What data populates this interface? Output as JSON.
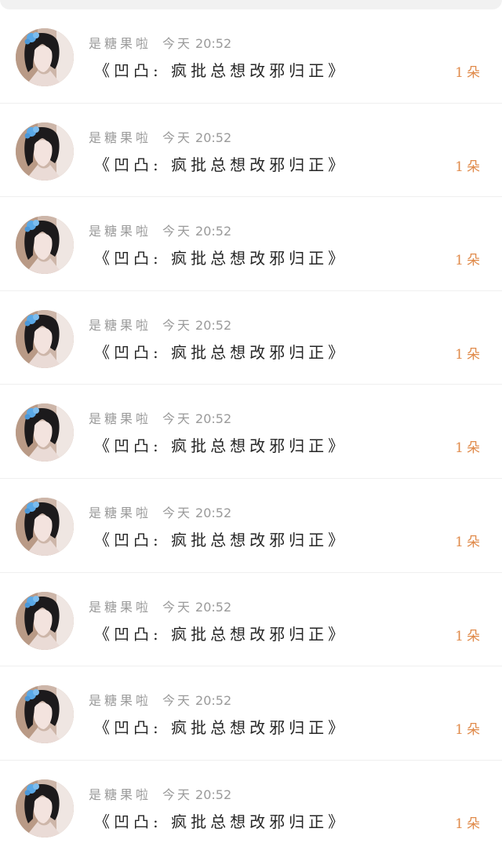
{
  "messages": [
    {
      "sender": "是糖果啦",
      "day": "今天",
      "time": "20:52",
      "text": "《凹凸: 疯批总想改邪归正》",
      "count": "1朵",
      "avatar": "avatar-girl-with-blue-flower"
    },
    {
      "sender": "是糖果啦",
      "day": "今天",
      "time": "20:52",
      "text": "《凹凸: 疯批总想改邪归正》",
      "count": "1朵",
      "avatar": "avatar-girl-with-blue-flower"
    },
    {
      "sender": "是糖果啦",
      "day": "今天",
      "time": "20:52",
      "text": "《凹凸: 疯批总想改邪归正》",
      "count": "1朵",
      "avatar": "avatar-girl-with-blue-flower"
    },
    {
      "sender": "是糖果啦",
      "day": "今天",
      "time": "20:52",
      "text": "《凹凸: 疯批总想改邪归正》",
      "count": "1朵",
      "avatar": "avatar-girl-with-blue-flower"
    },
    {
      "sender": "是糖果啦",
      "day": "今天",
      "time": "20:52",
      "text": "《凹凸: 疯批总想改邪归正》",
      "count": "1朵",
      "avatar": "avatar-girl-with-blue-flower"
    },
    {
      "sender": "是糖果啦",
      "day": "今天",
      "time": "20:52",
      "text": "《凹凸: 疯批总想改邪归正》",
      "count": "1朵",
      "avatar": "avatar-girl-with-blue-flower"
    },
    {
      "sender": "是糖果啦",
      "day": "今天",
      "time": "20:52",
      "text": "《凹凸: 疯批总想改邪归正》",
      "count": "1朵",
      "avatar": "avatar-girl-with-blue-flower"
    },
    {
      "sender": "是糖果啦",
      "day": "今天",
      "time": "20:52",
      "text": "《凹凸: 疯批总想改邪归正》",
      "count": "1朵",
      "avatar": "avatar-girl-with-blue-flower"
    },
    {
      "sender": "是糖果啦",
      "day": "今天",
      "time": "20:52",
      "text": "《凹凸: 疯批总想改邪归正》",
      "count": "1朵",
      "avatar": "avatar-girl-with-blue-flower"
    }
  ],
  "colors": {
    "accent": "#e08a4a",
    "meta_text": "#9a9a9a",
    "title_text": "#262626",
    "flower": "#5aa8e6"
  }
}
